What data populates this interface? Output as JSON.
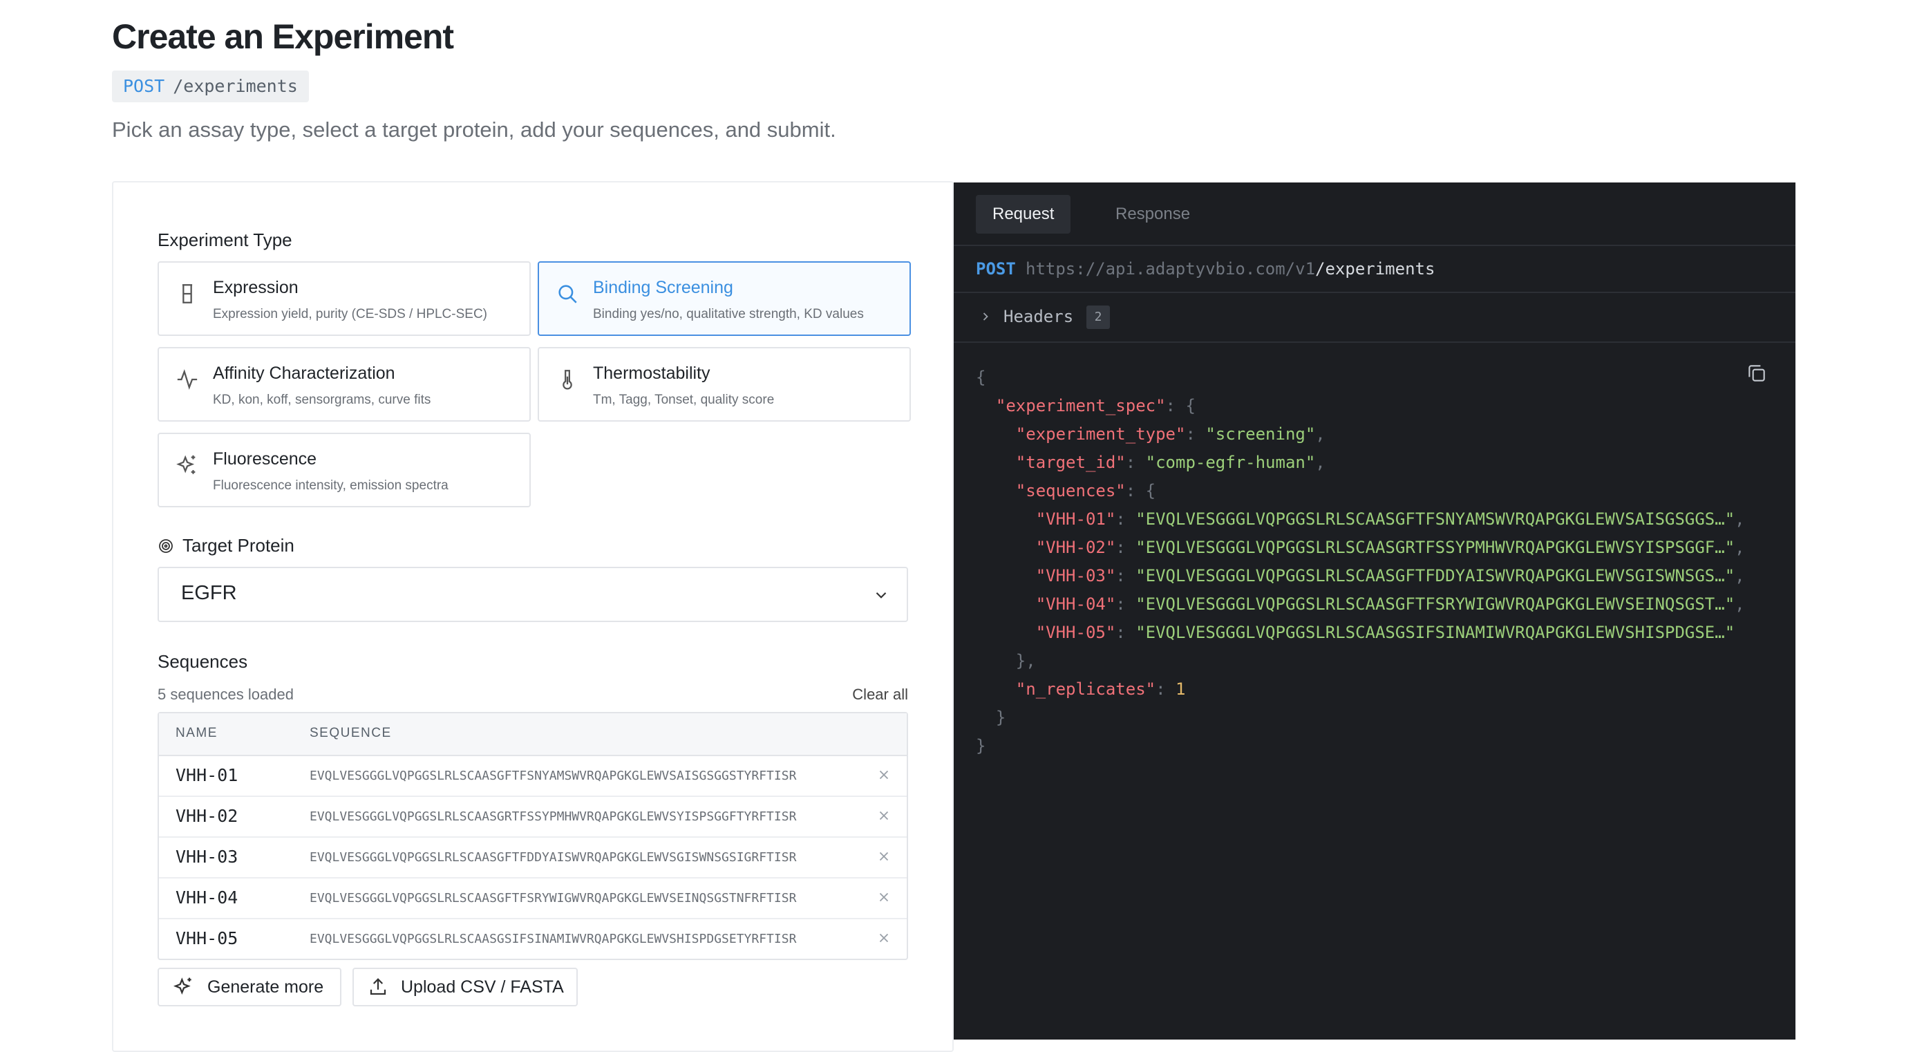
{
  "page": {
    "title": "Create an Experiment",
    "endpoint_method": "POST",
    "endpoint_path": "/experiments",
    "subtitle": "Pick an assay type, select a target protein, add your sequences, and submit."
  },
  "form": {
    "experiment_type_label": "Experiment Type",
    "cards": [
      {
        "title": "Expression",
        "desc": "Expression yield, purity (CE-SDS / HPLC-SEC)",
        "icon": "beaker-icon",
        "selected": false
      },
      {
        "title": "Binding Screening",
        "desc": "Binding yes/no, qualitative strength, KD values",
        "icon": "search-icon",
        "selected": true
      },
      {
        "title": "Affinity Characterization",
        "desc": "KD, kon, koff, sensorgrams, curve fits",
        "icon": "activity-icon",
        "selected": false
      },
      {
        "title": "Thermostability",
        "desc": "Tm, Tagg, Tonset, quality score",
        "icon": "thermometer-icon",
        "selected": false
      },
      {
        "title": "Fluorescence",
        "desc": "Fluorescence intensity, emission spectra",
        "icon": "sparkles-icon",
        "selected": false
      }
    ],
    "target_label": "Target Protein",
    "target_value": "EGFR",
    "sequences_label": "Sequences",
    "sequences_count": "5 sequences loaded",
    "clear_all": "Clear all",
    "table_headers": {
      "name": "NAME",
      "sequence": "SEQUENCE"
    },
    "rows": [
      {
        "name": "VHH-01",
        "seq": "EVQLVESGGGLVQPGGSLRLSCAASGFTFSNYAMSWVRQAPGKGLEWVSAISGSGGSTYRFTISR"
      },
      {
        "name": "VHH-02",
        "seq": "EVQLVESGGGLVQPGGSLRLSCAASGRTFSSYPMHWVRQAPGKGLEWVSYISPSGGFTYRFTISR"
      },
      {
        "name": "VHH-03",
        "seq": "EVQLVESGGGLVQPGGSLRLSCAASGFTFDDYAISWVRQAPGKGLEWVSGISWNSGSIGRFTISR"
      },
      {
        "name": "VHH-04",
        "seq": "EVQLVESGGGLVQPGGSLRLSCAASGFTFSRYWIGWVRQAPGKGLEWVSEINQSGSTNFRFTISR"
      },
      {
        "name": "VHH-05",
        "seq": "EVQLVESGGGLVQPGGSLRLSCAASGSIFSINAMIWVRQAPGKGLEWVSHISPDGSETYRFTISR"
      }
    ],
    "generate_more": "Generate more",
    "upload": "Upload CSV / FASTA"
  },
  "code_panel": {
    "tab_request": "Request",
    "tab_response": "Response",
    "method": "POST",
    "url_host": "https://api.adaptyvbio.com/v1",
    "url_path": "/experiments",
    "headers_label": "Headers",
    "headers_count": "2",
    "json": {
      "experiment_spec_key": "\"experiment_spec\"",
      "experiment_type_key": "\"experiment_type\"",
      "experiment_type_val": "\"screening\"",
      "target_id_key": "\"target_id\"",
      "target_id_val": "\"comp-egfr-human\"",
      "sequences_key": "\"sequences\"",
      "seq_entries": [
        {
          "key": "\"VHH-01\"",
          "val": "\"EVQLVESGGGLVQPGGSLRLSCAASGFTFSNYAMSWVRQAPGKGLEWVSAISGSGGS…\""
        },
        {
          "key": "\"VHH-02\"",
          "val": "\"EVQLVESGGGLVQPGGSLRLSCAASGRTFSSYPMHWVRQAPGKGLEWVSYISPSGGF…\""
        },
        {
          "key": "\"VHH-03\"",
          "val": "\"EVQLVESGGGLVQPGGSLRLSCAASGFTFDDYAISWVRQAPGKGLEWVSGISWNSGS…\""
        },
        {
          "key": "\"VHH-04\"",
          "val": "\"EVQLVESGGGLVQPGGSLRLSCAASGFTFSRYWIGWVRQAPGKGLEWVSEINQSGST…\""
        },
        {
          "key": "\"VHH-05\"",
          "val": "\"EVQLVESGGGLVQPGGSLRLSCAASGSIFSINAMIWVRQAPGKGLEWVSHISPDGSE…\""
        }
      ],
      "n_replicates_key": "\"n_replicates\"",
      "n_replicates_val": "1"
    }
  },
  "colors": {
    "accent": "#3a8fe0",
    "code_bg": "#1c1e22",
    "json_key": "#f07178",
    "json_string": "#9ccf7a",
    "json_number": "#e4b96a"
  }
}
